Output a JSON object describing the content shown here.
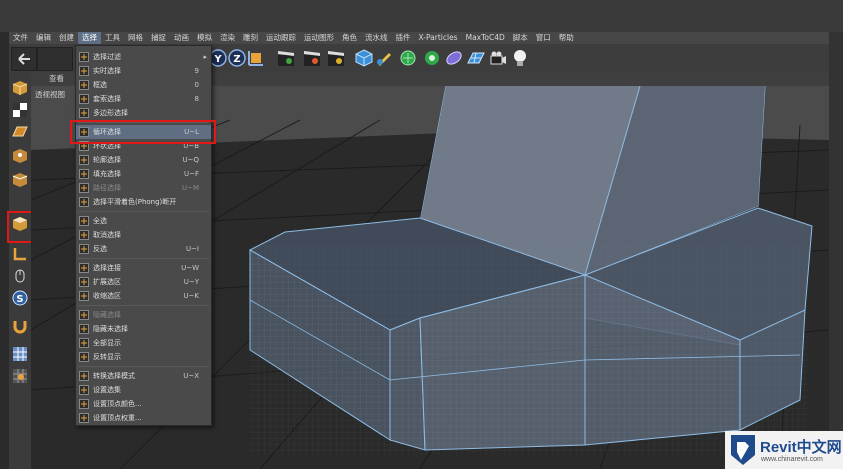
{
  "menubar": {
    "items": [
      "文件",
      "编辑",
      "创建",
      "选择",
      "工具",
      "网格",
      "捕捉",
      "动画",
      "模拟",
      "渲染",
      "雕刻",
      "运动跟踪",
      "运动图形",
      "角色",
      "流水线",
      "插件",
      "X-Particles",
      "MaxToC4D",
      "脚本",
      "窗口",
      "帮助"
    ],
    "active_index": 3
  },
  "viewport": {
    "header_label": "查看",
    "title": "透视视图"
  },
  "select_menu": {
    "items": [
      {
        "label": "选择过滤",
        "shortcut": "",
        "submenu": true,
        "icon": "filter-icon"
      },
      {
        "label": "实时选择",
        "shortcut": "9",
        "icon": "live-select-icon"
      },
      {
        "label": "框选",
        "shortcut": "0",
        "icon": "rect-select-icon"
      },
      {
        "label": "套索选择",
        "shortcut": "8",
        "icon": "lasso-icon"
      },
      {
        "label": "多边形选择",
        "shortcut": "",
        "icon": "polygon-select-icon"
      },
      {
        "label": "循环选择",
        "shortcut": "U~L",
        "selected": true,
        "icon": "loop-select-icon"
      },
      {
        "label": "环状选择",
        "shortcut": "U~B",
        "icon": "ring-select-icon"
      },
      {
        "label": "轮廓选择",
        "shortcut": "U~Q",
        "icon": "outline-select-icon"
      },
      {
        "label": "填充选择",
        "shortcut": "U~F",
        "icon": "fill-select-icon"
      },
      {
        "label": "路径选择",
        "shortcut": "U~M",
        "disabled": true,
        "icon": "path-select-icon"
      },
      {
        "label": "选择平滑着色(Phong)断开",
        "shortcut": "",
        "icon": "phong-break-icon"
      },
      {
        "label": "全选",
        "shortcut": "",
        "icon": "select-all-icon"
      },
      {
        "label": "取消选择",
        "shortcut": "",
        "icon": "deselect-icon"
      },
      {
        "label": "反选",
        "shortcut": "U~I",
        "icon": "invert-select-icon"
      },
      {
        "label": "选择连接",
        "shortcut": "U~W",
        "icon": "select-connected-icon"
      },
      {
        "label": "扩展选区",
        "shortcut": "U~Y",
        "icon": "grow-select-icon"
      },
      {
        "label": "收缩选区",
        "shortcut": "U~K",
        "icon": "shrink-select-icon"
      },
      {
        "label": "隐藏选择",
        "shortcut": "",
        "disabled": true,
        "icon": "hide-selected-icon"
      },
      {
        "label": "隐藏未选择",
        "shortcut": "",
        "icon": "hide-unselected-icon"
      },
      {
        "label": "全部显示",
        "shortcut": "",
        "icon": "unhide-all-icon"
      },
      {
        "label": "反转显示",
        "shortcut": "",
        "icon": "invert-visibility-icon"
      },
      {
        "label": "转换选择模式",
        "shortcut": "U~X",
        "icon": "convert-selection-icon"
      },
      {
        "label": "设置选集",
        "shortcut": "",
        "icon": "set-selection-icon"
      },
      {
        "label": "设置顶点颜色...",
        "shortcut": "",
        "icon": "vertex-color-icon"
      },
      {
        "label": "设置顶点权重...",
        "shortcut": "",
        "icon": "vertex-weight-icon"
      }
    ]
  },
  "watermark": {
    "brand": "Revit中文网",
    "url": "www.chinarevit.com"
  },
  "colors": {
    "accent_red": "#e01818",
    "highlight": "#5f6e82",
    "mesh_edge": "#7fb0e0"
  }
}
